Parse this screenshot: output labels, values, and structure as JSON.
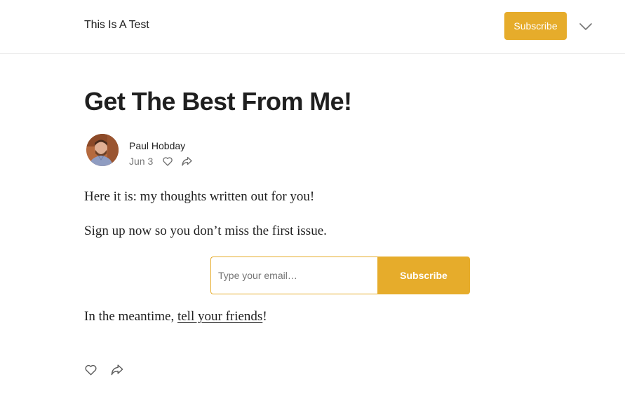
{
  "header": {
    "site_title": "This Is A Test",
    "subscribe_label": "Subscribe",
    "menu_icon": "chevron-down-icon"
  },
  "post": {
    "title": "Get The Best From Me!",
    "author": "Paul Hobday",
    "date": "Jun 3",
    "paragraphs": [
      "Here it is: my thoughts written out for you!",
      "Sign up now so you don’t miss the first issue."
    ],
    "outro_prefix": "In the meantime, ",
    "outro_link": "tell your friends",
    "outro_suffix": "!"
  },
  "subscribe_form": {
    "placeholder": "Type your email…",
    "button_label": "Subscribe"
  },
  "icons": {
    "like": "heart-icon",
    "share": "share-icon"
  },
  "colors": {
    "accent": "#e6ac2b",
    "text": "#1f1f1f",
    "muted": "#757575"
  }
}
